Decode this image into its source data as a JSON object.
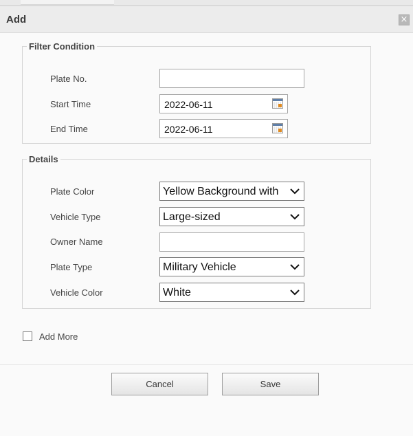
{
  "dialog": {
    "title": "Add",
    "close_symbol": "×"
  },
  "filter_condition": {
    "legend": "Filter Condition",
    "plate_no": {
      "label": "Plate No.",
      "value": ""
    },
    "start_time": {
      "label": "Start Time",
      "value": "2022-06-11",
      "icon": "calendar-icon"
    },
    "end_time": {
      "label": "End Time",
      "value": "2022-06-11",
      "icon": "calendar-icon"
    }
  },
  "details": {
    "legend": "Details",
    "plate_color": {
      "label": "Plate Color",
      "value": "Yellow Background with"
    },
    "vehicle_type": {
      "label": "Vehicle Type",
      "value": "Large-sized"
    },
    "owner_name": {
      "label": "Owner Name",
      "value": ""
    },
    "plate_type": {
      "label": "Plate Type",
      "value": "Military Vehicle"
    },
    "vehicle_color": {
      "label": "Vehicle Color",
      "value": "White"
    }
  },
  "add_more": {
    "label": "Add More",
    "checked": false
  },
  "buttons": {
    "cancel": "Cancel",
    "save": "Save"
  }
}
